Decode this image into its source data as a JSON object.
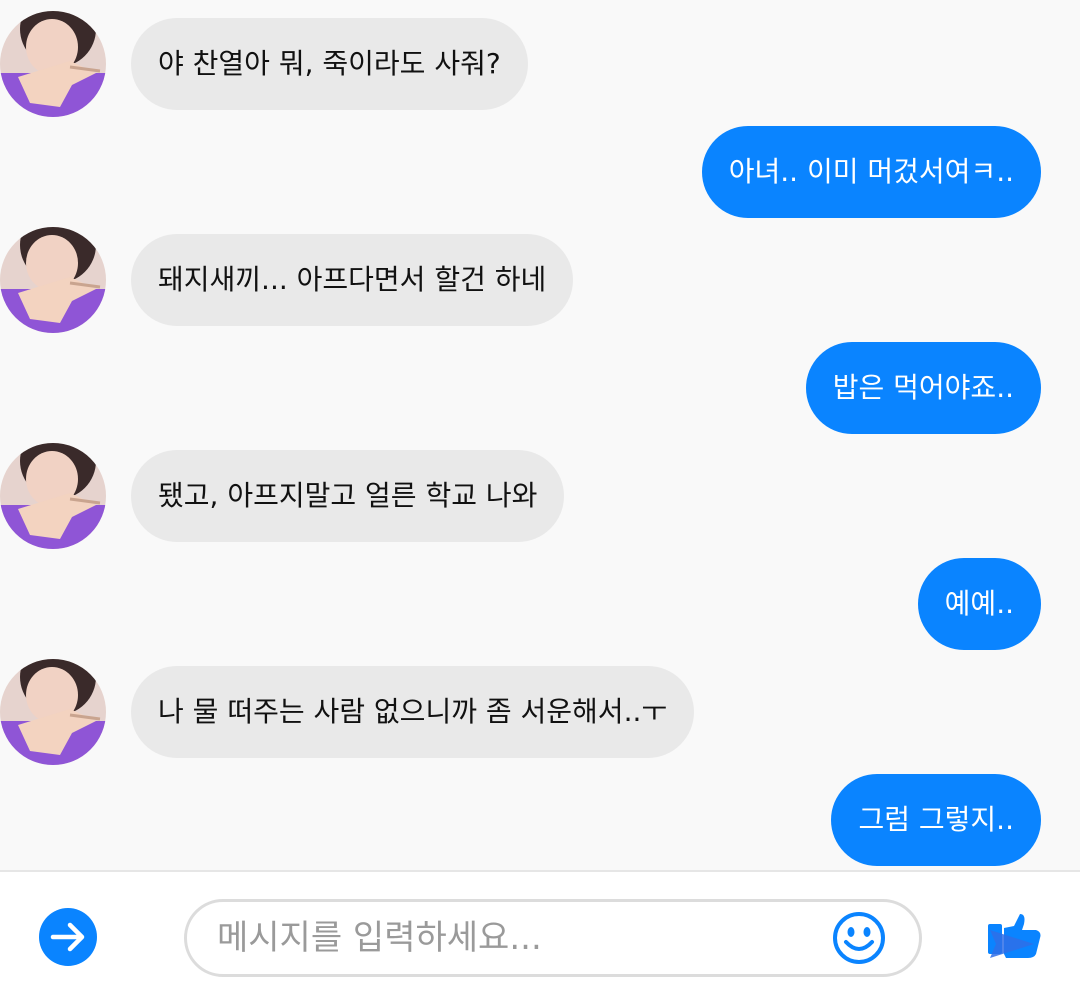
{
  "conversation": {
    "messages": [
      {
        "side": "in",
        "text": "야 찬열아 뭐, 죽이라도 사줘?"
      },
      {
        "side": "out",
        "text": "아녀.. 이미 머겄서여ㅋ.."
      },
      {
        "side": "in",
        "text": "돼지새끼... 아프다면서 할건 하네"
      },
      {
        "side": "out",
        "text": "밥은 먹어야죠.."
      },
      {
        "side": "in",
        "text": "됐고, 아프지말고 얼른 학교 나와"
      },
      {
        "side": "out",
        "text": "예예.."
      },
      {
        "side": "in",
        "text": "나 물 떠주는 사람 없으니까 좀 서운해서..ㅜ"
      },
      {
        "side": "out",
        "text": "그럼 그렇지.."
      }
    ]
  },
  "composer": {
    "placeholder": "메시지를 입력하세요...",
    "left_icon": "arrow-right-circle-icon",
    "emoji_icon": "smiley-icon",
    "send_icon": "send-thumb-icon"
  },
  "colors": {
    "accent": "#0a84ff",
    "incoming_bubble": "#e9e9e9",
    "chat_background": "#f9f9f9"
  }
}
